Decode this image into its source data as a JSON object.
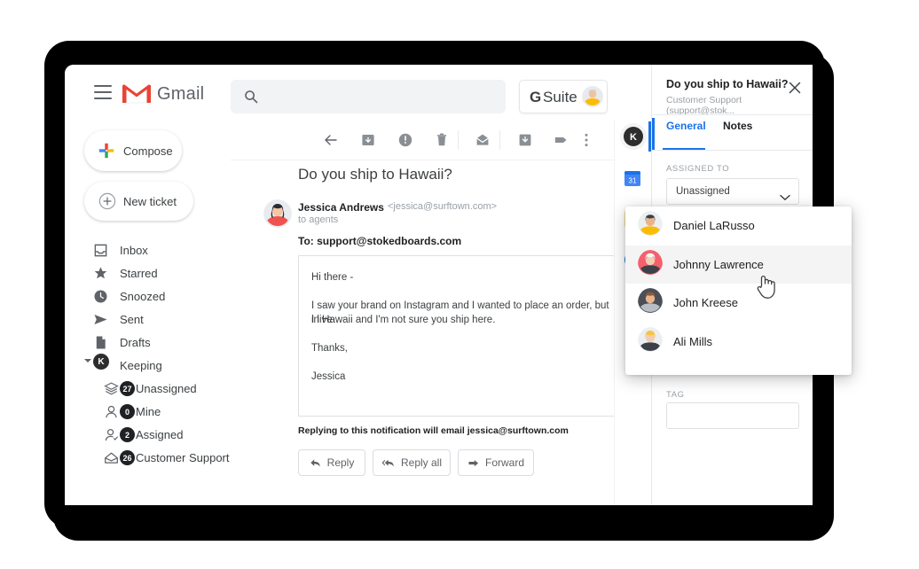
{
  "app": {
    "brand": "Gmail",
    "hamburger_icon": "hamburger-menu-icon",
    "gmail_logo_icon": "gmail-logo-icon",
    "accent_blue": "#1a73e8",
    "badge_dark": "#202124"
  },
  "search": {
    "placeholder": "",
    "value": "",
    "icon": "search-icon"
  },
  "gsuite": {
    "g": "G",
    "label": "Suite",
    "avatar_icon": "user-avatar"
  },
  "sidebar": {
    "compose_label": "Compose",
    "new_ticket_label": "New ticket",
    "items": [
      {
        "label": "Inbox",
        "icon": "inbox-icon",
        "badge": null,
        "indent": false
      },
      {
        "label": "Starred",
        "icon": "star-icon",
        "badge": null,
        "indent": false
      },
      {
        "label": "Snoozed",
        "icon": "clock-icon",
        "badge": null,
        "indent": false
      },
      {
        "label": "Sent",
        "icon": "send-icon",
        "badge": null,
        "indent": false
      },
      {
        "label": "Drafts",
        "icon": "document-icon",
        "badge": null,
        "indent": false
      },
      {
        "label": "Keeping",
        "icon": "keeping-logo-icon",
        "badge": null,
        "indent": false
      },
      {
        "label": "Unassigned",
        "icon": "layers-icon",
        "badge": "27",
        "indent": true
      },
      {
        "label": "Mine",
        "icon": "person-icon",
        "badge": "0",
        "indent": true
      },
      {
        "label": "Assigned",
        "icon": "person-check-icon",
        "badge": "2",
        "indent": true
      },
      {
        "label": "Customer Support",
        "icon": "envelope-icon",
        "badge": "26",
        "indent": true
      }
    ]
  },
  "toolbar": {
    "icons": [
      "back-arrow-icon",
      "archive-icon",
      "report-spam-icon",
      "delete-icon",
      "mark-unread-icon",
      "move-to-inbox-icon",
      "label-icon",
      "more-options-icon"
    ]
  },
  "message": {
    "subject": "Do you ship to Hawaii?",
    "sender_name": "Jessica Andrews",
    "sender_email": "<jessica@surftown.com>",
    "sender_to": "to agents",
    "recipient_line": "To: support@stokedboards.com",
    "avatar_icon": "sender-avatar",
    "body_lines": [
      "Hi there -",
      "I saw your brand on Instagram and I wanted to place an order, but I live",
      "in Hawaii and I'm not sure you ship here.",
      "Thanks,",
      "Jessica"
    ],
    "reply_note": "Replying to this notification will email jessica@surftown.com",
    "actions": [
      {
        "label": "Reply",
        "icon": "reply-icon"
      },
      {
        "label": "Reply all",
        "icon": "reply-all-icon"
      },
      {
        "label": "Forward",
        "icon": "forward-icon"
      }
    ]
  },
  "rail": {
    "items": [
      {
        "icon": "keeping-app-icon",
        "active": true
      },
      {
        "icon": "google-calendar-icon",
        "active": false
      },
      {
        "icon": "google-keep-icon",
        "active": false
      },
      {
        "icon": "google-tasks-icon",
        "active": false
      }
    ],
    "add_label": "+"
  },
  "panel": {
    "title": "Do you ship to Hawaii?",
    "subtitle": "Customer Support (support@stok...",
    "close_icon": "close-icon",
    "tabs": [
      {
        "label": "General",
        "active": true
      },
      {
        "label": "Notes",
        "active": false
      }
    ],
    "assigned_to_label": "ASSIGNED TO",
    "assigned_to_value": "Unassigned",
    "assigned_to_caret": "chevron-down-icon",
    "tag_label": "TAG",
    "tag_value": ""
  },
  "dropdown": {
    "options": [
      {
        "name": "Daniel LaRusso",
        "avatar": "avatar-daniel",
        "highlighted": false
      },
      {
        "name": "Johnny Lawrence",
        "avatar": "avatar-johnny",
        "highlighted": true
      },
      {
        "name": "John Kreese",
        "avatar": "avatar-john",
        "highlighted": false
      },
      {
        "name": "Ali Mills",
        "avatar": "avatar-ali",
        "highlighted": false
      }
    ]
  },
  "cursor": {
    "type": "pointer-hand-cursor"
  }
}
